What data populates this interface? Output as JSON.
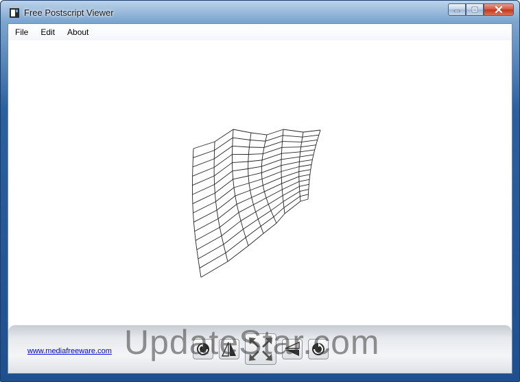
{
  "window": {
    "title": "Free Postscript Viewer",
    "icon": "postscript-app-icon"
  },
  "caption_buttons": {
    "minimize_icon": "minimize-icon",
    "maximize_icon": "maximize-icon",
    "close_icon": "close-icon"
  },
  "menu": {
    "items": [
      "File",
      "Edit",
      "About"
    ]
  },
  "document": {
    "content": "wireframe-surface-drawing"
  },
  "bottom_bar": {
    "link_text": "www.mediafreeware.com",
    "buttons": [
      {
        "name": "rotate-left-button",
        "icon": "rotate-counterclockwise-icon"
      },
      {
        "name": "flip-horizontal-button",
        "icon": "flip-horizontal-icon"
      },
      {
        "name": "fit-to-window-button",
        "icon": "expand-arrows-icon"
      },
      {
        "name": "flip-vertical-button",
        "icon": "flip-vertical-icon"
      },
      {
        "name": "rotate-right-button",
        "icon": "rotate-clockwise-icon"
      }
    ]
  },
  "watermark": {
    "text": "UpdateStar.com"
  },
  "colors": {
    "accent_frame": "#2b5f9e",
    "close_button": "#c2361e",
    "link": "#0000ee"
  }
}
